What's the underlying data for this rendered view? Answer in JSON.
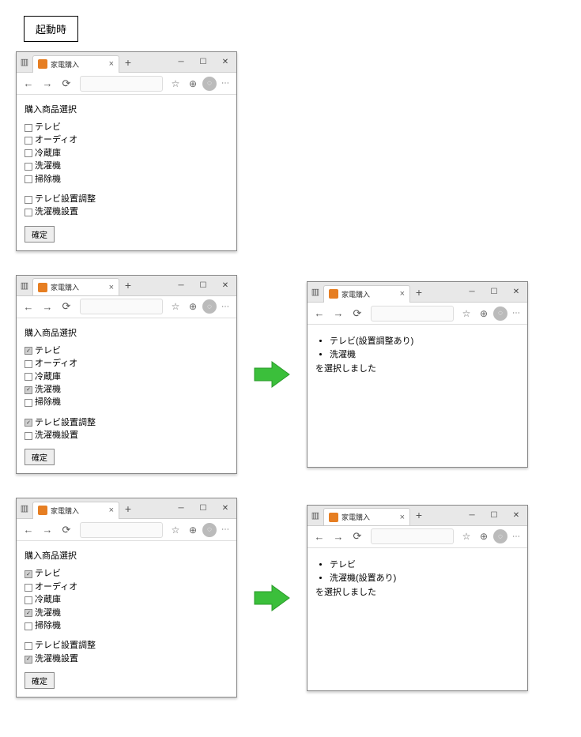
{
  "section_title": "起動時",
  "tab_title": "家電購入",
  "heading": "購入商品選択",
  "products": [
    "テレビ",
    "オーディオ",
    "冷蔵庫",
    "洗濯機",
    "掃除機"
  ],
  "services": [
    "テレビ設置調整",
    "洗濯機設置"
  ],
  "confirm_label": "確定",
  "result_suffix": "を選択しました",
  "win1": {
    "products_checked": [
      false,
      false,
      false,
      false,
      false
    ],
    "services_checked": [
      false,
      false
    ]
  },
  "win2": {
    "products_checked": [
      true,
      false,
      false,
      true,
      false
    ],
    "services_checked": [
      true,
      false
    ],
    "result_items": [
      "テレビ(設置調整あり)",
      "洗濯機"
    ]
  },
  "win3": {
    "products_checked": [
      true,
      false,
      false,
      true,
      false
    ],
    "services_checked": [
      false,
      true
    ],
    "result_items": [
      "テレビ",
      "洗濯機(設置あり)"
    ]
  }
}
